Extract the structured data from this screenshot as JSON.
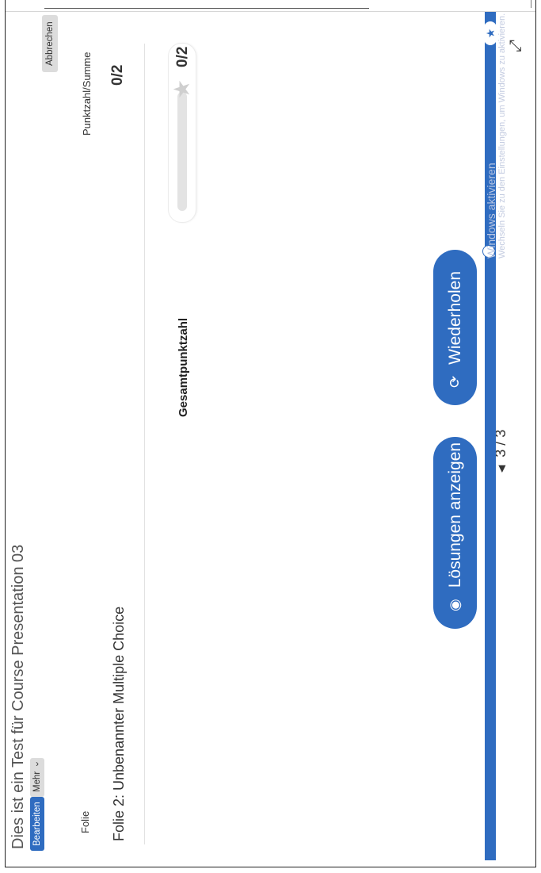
{
  "page": {
    "title": "Dies ist ein Test für Course Presentation 03"
  },
  "toolbar": {
    "edit_label": "Bearbeiten",
    "more_label": "Mehr",
    "more_chevron": "›",
    "cancel_label": "Abbrechen"
  },
  "results_table": {
    "col_slide": "Folie",
    "col_score": "Punktzahl/Summe",
    "rows": [
      {
        "slide": "Folie 2: Unbenannter Multiple Choice",
        "score": "0/2"
      }
    ]
  },
  "total": {
    "label": "Gesamtpunktzahl",
    "score": "0/2",
    "fill_fraction": 0,
    "star_icon": "star-icon"
  },
  "actions": {
    "show_solutions_label": "Lösungen anzeigen",
    "show_solutions_icon": "eye-icon",
    "retry_label": "Wiederholen",
    "retry_icon": "refresh-icon"
  },
  "navigation": {
    "prev_icon": "arrow-left-icon",
    "page_indicator": "3 / 3"
  },
  "watermark": {
    "line1": "Windows aktivieren",
    "line2": "Wechseln Sie zu den Einstellungen, um Windows zu aktivieren."
  },
  "colors": {
    "accent": "#2f6cc0",
    "neutral_button": "#dcdcdc"
  }
}
